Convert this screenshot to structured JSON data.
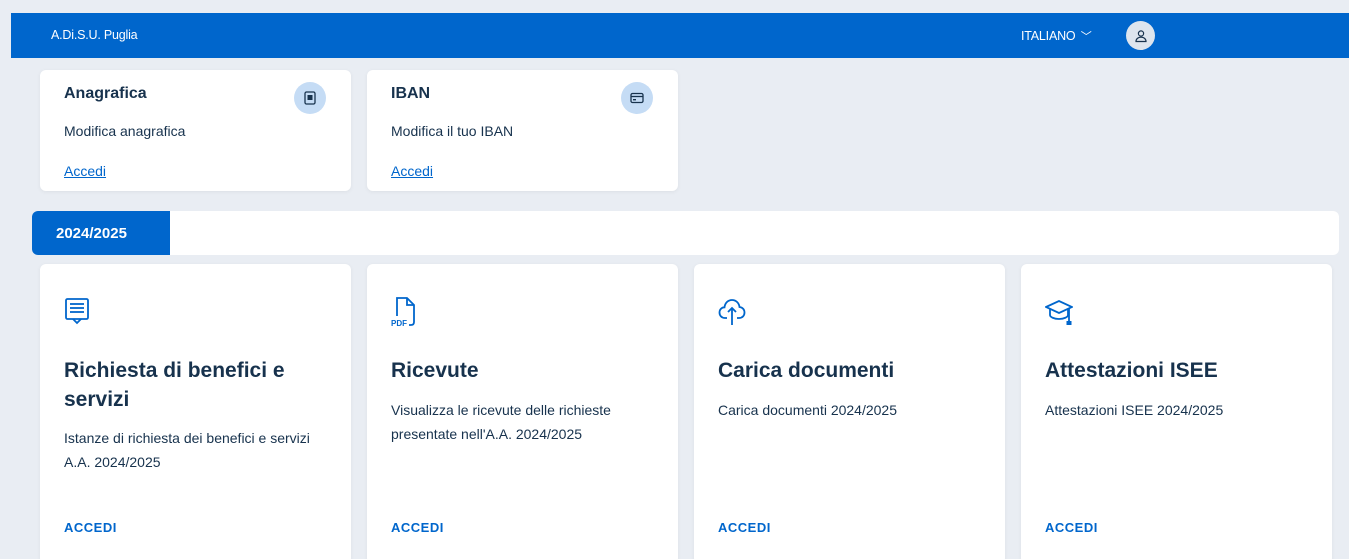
{
  "header": {
    "brand": "A.Di.S.U. Puglia",
    "language": "ITALIANO",
    "language_chevron": "﹀",
    "avatar_icon": "user-icon"
  },
  "quick_cards": [
    {
      "title": "Anagrafica",
      "description": "Modifica anagrafica",
      "link": "Accedi",
      "icon": "id-card-icon"
    },
    {
      "title": "IBAN",
      "description": "Modifica il tuo IBAN",
      "link": "Accedi",
      "icon": "credit-card-icon"
    }
  ],
  "year_tab": {
    "label": "2024/2025"
  },
  "service_cards": [
    {
      "title": "Richiesta di benefici e servizi",
      "description": "Istanze di richiesta dei benefici e servizi A.A. 2024/2025",
      "action": "ACCEDI",
      "icon": "form-icon"
    },
    {
      "title": "Ricevute",
      "description": "Visualizza le ricevute delle richieste presentate nell'A.A. 2024/2025",
      "action": "ACCEDI",
      "icon": "pdf-icon",
      "icon_label": "PDF"
    },
    {
      "title": "Carica documenti",
      "description": "Carica documenti 2024/2025",
      "action": "ACCEDI",
      "icon": "cloud-upload-icon"
    },
    {
      "title": "Attestazioni ISEE",
      "description": "Attestazioni ISEE 2024/2025",
      "action": "ACCEDI",
      "icon": "graduation-cap-icon"
    }
  ],
  "colors": {
    "primary": "#0066cc",
    "background": "#e9edf3",
    "text": "#17324d",
    "icon_circle": "#c5dcf5"
  }
}
